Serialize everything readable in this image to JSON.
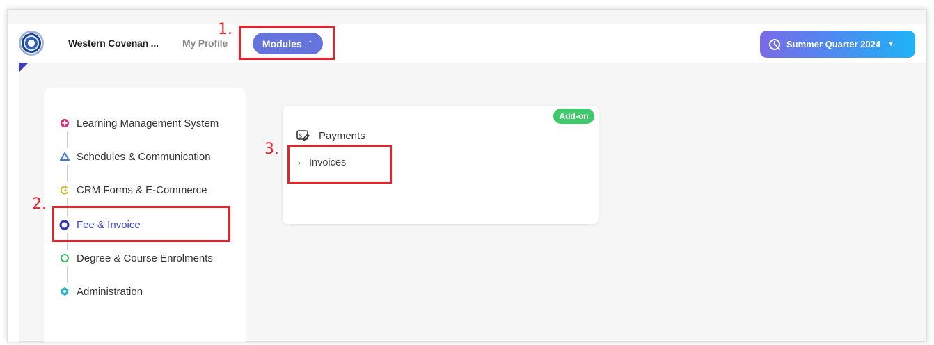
{
  "header": {
    "org_name": "Western Covenan ...",
    "my_profile": "My Profile",
    "modules_label": "Modules",
    "quarter_label": "Summer Quarter 2024",
    "icons": {
      "logo": "school-seal-logo",
      "modules_chevron": "chevron-up-icon",
      "quarter_icon": "calendar-clock-icon",
      "quarter_caret": "caret-down-icon"
    }
  },
  "sidebar": {
    "items": [
      {
        "label": "Learning Management System",
        "icon": "lms-icon",
        "color": "#d6307d"
      },
      {
        "label": "Schedules & Communication",
        "icon": "triangle-icon",
        "color": "#3a7bd5"
      },
      {
        "label": "CRM Forms & E-Commerce",
        "icon": "crm-icon",
        "color": "#d4b020"
      },
      {
        "label": "Fee & Invoice",
        "icon": "ring-icon",
        "color": "#2f34b5",
        "active": true
      },
      {
        "label": "Degree & Course Enrolments",
        "icon": "ring-icon",
        "color": "#3bbf5a"
      },
      {
        "label": "Administration",
        "icon": "gear-icon",
        "color": "#2ab6c8"
      }
    ]
  },
  "panel": {
    "badge": "Add-on",
    "section_title": "Payments",
    "section_icon": "payments-icon",
    "link_label": "Invoices",
    "link_icon": "chevron-right-icon"
  },
  "annotations": {
    "step1": "1.",
    "step2": "2.",
    "step3": "3.",
    "color": "#e4242b"
  },
  "colors": {
    "accent": "#6574dc",
    "badge_green": "#3fc96a",
    "active_item": "#3b44c8"
  }
}
